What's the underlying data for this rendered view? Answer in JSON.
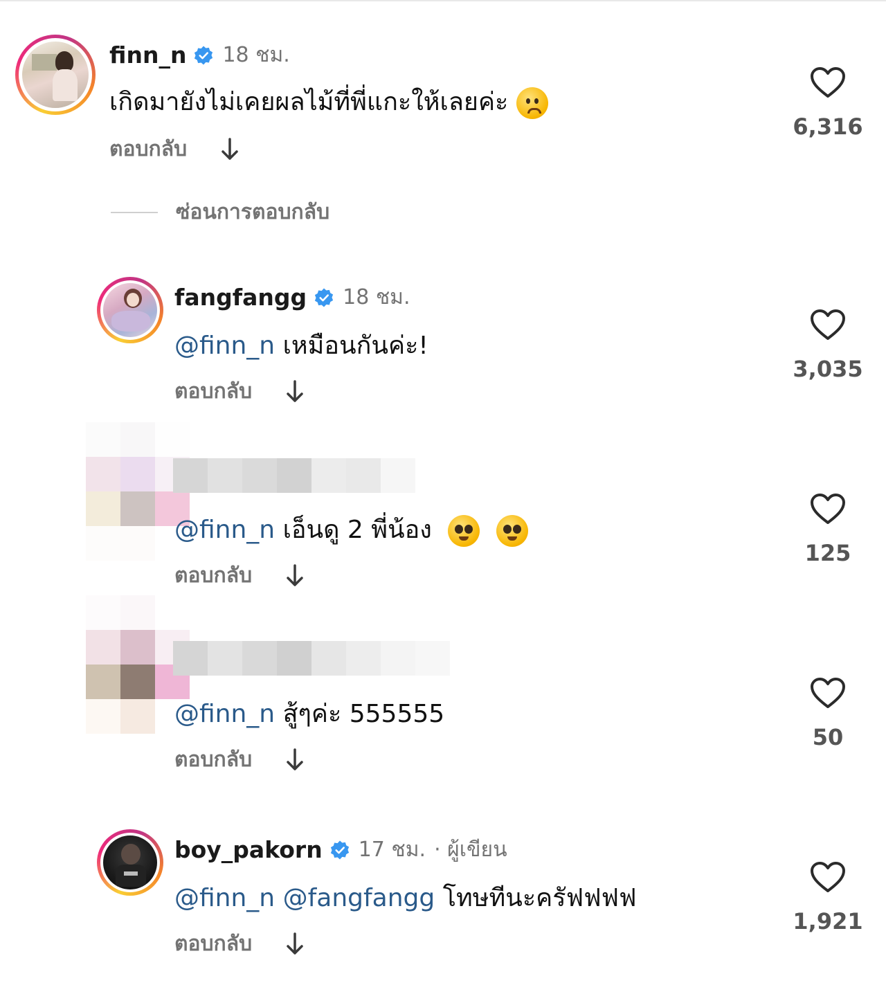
{
  "hide_replies_label": "ซ่อนการตอบกลับ",
  "colors": {
    "mention": "#2a5a8a",
    "verified": "#3897f0",
    "secondary_text": "#737373"
  },
  "comments": [
    {
      "username": "finn_n",
      "verified": true,
      "time": "18 ชม.",
      "text": "เกิดมายังไม่เคยผลไม้ที่พี่แกะให้เลยค่ะ",
      "emoji": "frowning-face-emoji",
      "reply_label": "ตอบกลับ",
      "likes": "6,316"
    },
    {
      "username": "fangfangg",
      "verified": true,
      "time": "18 ชม.",
      "mention": "@finn_n",
      "text": "เหมือนกันค่ะ!",
      "reply_label": "ตอบกลับ",
      "likes": "3,035"
    },
    {
      "username": "",
      "blurred": true,
      "mention": "@finn_n",
      "text": "เอ็นดู 2 พี่น้อง",
      "emoji": "pleading-face-emoji",
      "reply_label": "ตอบกลับ",
      "likes": "125"
    },
    {
      "username": "",
      "blurred": true,
      "mention": "@finn_n",
      "text": "สู้ๆค่ะ 555555",
      "reply_label": "ตอบกลับ",
      "likes": "50"
    },
    {
      "username": "boy_pakorn",
      "verified": true,
      "time": "17 ชม.",
      "author_badge": "· ผู้เขียน",
      "mention": "@finn_n",
      "mention2": "@fangfangg",
      "text": "โทษทีนะครัฟฟฟฟ",
      "reply_label": "ตอบกลับ",
      "likes": "1,921"
    }
  ]
}
